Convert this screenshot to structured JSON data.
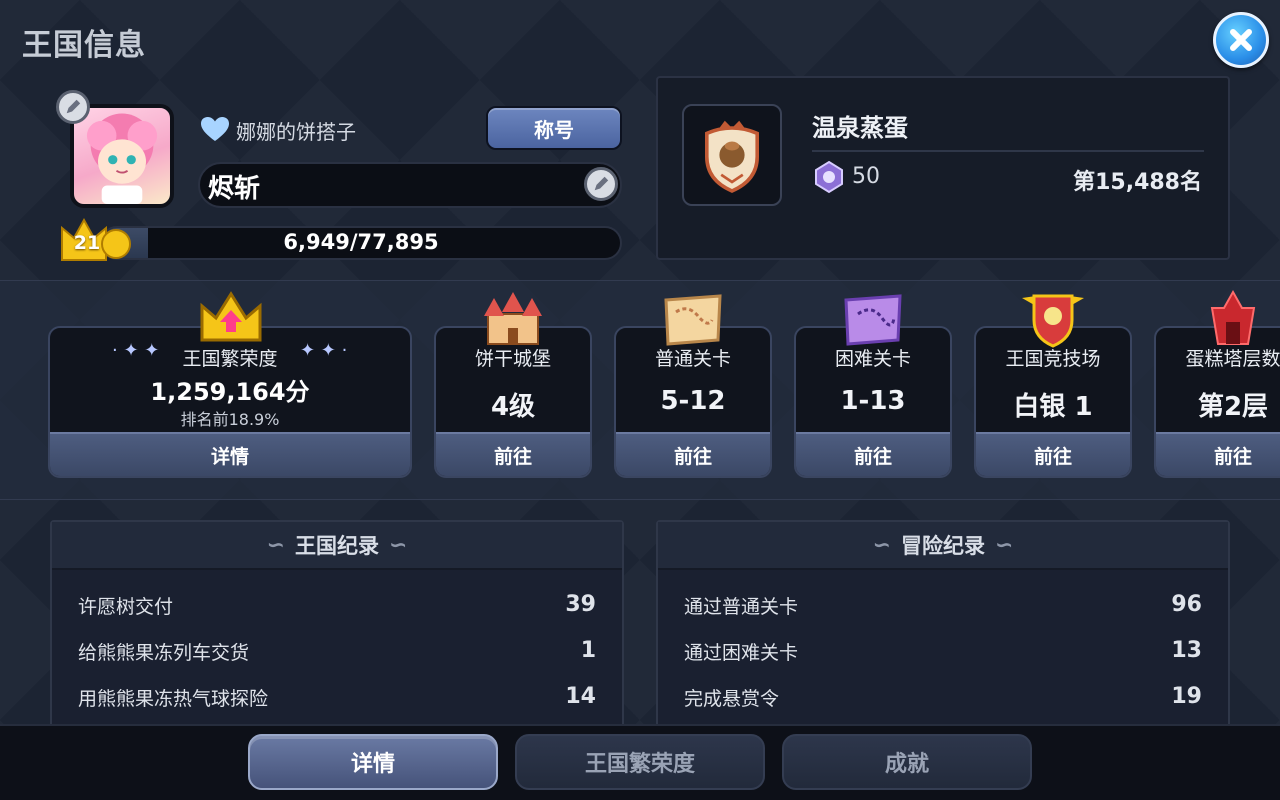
{
  "header": {
    "title": "王国信息"
  },
  "profile": {
    "guild_name": "娜娜的饼搭子",
    "rank_title_button": "称号",
    "player_name": "烬斩",
    "level": "21",
    "xp_text": "6,949/77,895",
    "xp_progress": 0.0892
  },
  "league": {
    "name": "温泉蒸蛋",
    "trophies": "50",
    "rank": "第15,488名"
  },
  "stats": [
    {
      "label": "王国繁荣度",
      "value": "1,259,164分",
      "sub": "排名前18.9%",
      "button": "详情",
      "icon": "crown-icon"
    },
    {
      "label": "饼干城堡",
      "value": "4级",
      "button": "前往",
      "icon": "castle-icon"
    },
    {
      "label": "普通关卡",
      "value": "5-12",
      "button": "前往",
      "icon": "map-icon"
    },
    {
      "label": "困难关卡",
      "value": "1-13",
      "button": "前往",
      "icon": "hard-map-icon"
    },
    {
      "label": "王国竞技场",
      "value": "白银 1",
      "button": "前往",
      "icon": "arena-shield-icon"
    },
    {
      "label": "蛋糕塔层数",
      "value": "第2层",
      "button": "前往",
      "icon": "tower-icon"
    }
  ],
  "kingdom_records": {
    "title": "王国纪录",
    "rows": [
      {
        "label": "许愿树交付",
        "value": "39"
      },
      {
        "label": "给熊熊果冻列车交货",
        "value": "1"
      },
      {
        "label": "用熊熊果冻热气球探险",
        "value": "14"
      }
    ]
  },
  "adventure_records": {
    "title": "冒险纪录",
    "rows": [
      {
        "label": "通过普通关卡",
        "value": "96"
      },
      {
        "label": "通过困难关卡",
        "value": "13"
      },
      {
        "label": "完成悬赏令",
        "value": "19"
      }
    ]
  },
  "tabs": [
    {
      "label": "详情",
      "active": true
    },
    {
      "label": "王国繁荣度",
      "active": false
    },
    {
      "label": "成就",
      "active": false
    }
  ],
  "colors": {
    "accent_blue": "#2a8ee8",
    "gold": "#f5c518",
    "button": "#4b64a0"
  }
}
